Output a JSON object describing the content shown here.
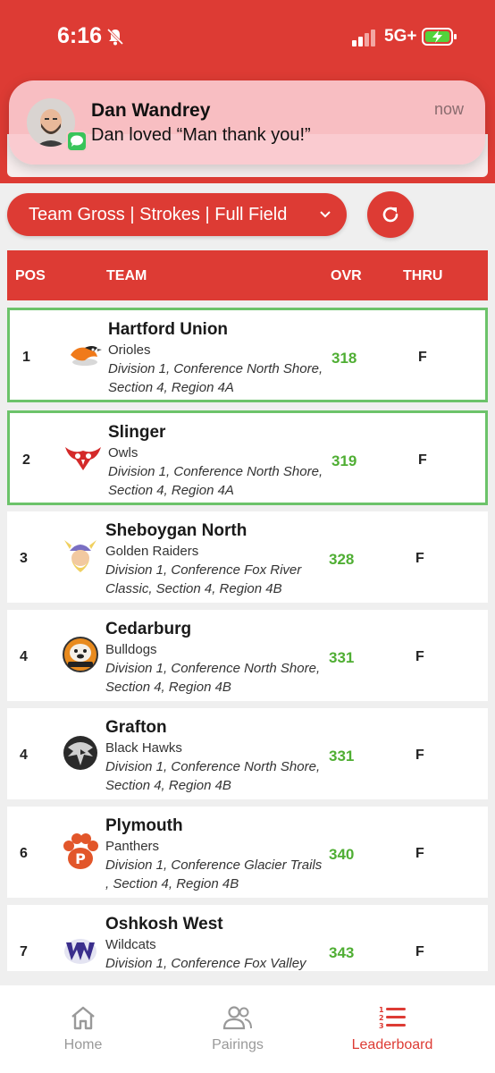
{
  "status_bar": {
    "time": "6:16",
    "network": "5G+"
  },
  "notification": {
    "sender": "Dan Wandrey",
    "message": "Dan loved “Man thank you!”",
    "time": "now"
  },
  "filter": {
    "label": "Team Gross | Strokes | Full Field"
  },
  "table": {
    "headers": {
      "pos": "POS",
      "team": "TEAM",
      "ovr": "OVR",
      "thru": "THRU"
    },
    "rows": [
      {
        "pos": "1",
        "team": "Hartford Union",
        "mascot": "Orioles",
        "info": "Division 1, Conference North Shore, Section 4, Region 4A",
        "ovr": "318",
        "thru": "F",
        "logo": "oriole-logo-icon"
      },
      {
        "pos": "2",
        "team": "Slinger",
        "mascot": "Owls",
        "info": "Division 1, Conference North Shore, Section 4, Region 4A",
        "ovr": "319",
        "thru": "F",
        "logo": "owl-logo-icon"
      },
      {
        "pos": "3",
        "team": "Sheboygan North",
        "mascot": "Golden Raiders",
        "info": "Division 1, Conference Fox River Classic, Section 4, Region 4B",
        "ovr": "328",
        "thru": "F",
        "logo": "raider-logo-icon"
      },
      {
        "pos": "4",
        "team": "Cedarburg",
        "mascot": "Bulldogs",
        "info": "Division 1, Conference North Shore, Section 4, Region 4B",
        "ovr": "331",
        "thru": "F",
        "logo": "bulldog-logo-icon"
      },
      {
        "pos": "4",
        "team": "Grafton",
        "mascot": "Black Hawks",
        "info": "Division 1, Conference North Shore, Section 4, Region 4B",
        "ovr": "331",
        "thru": "F",
        "logo": "hawk-logo-icon"
      },
      {
        "pos": "6",
        "team": "Plymouth",
        "mascot": "Panthers",
        "info": "Division 1, Conference Glacier Trails , Section 4, Region 4B",
        "ovr": "340",
        "thru": "F",
        "logo": "panther-paw-logo-icon"
      },
      {
        "pos": "7",
        "team": "Oshkosh West",
        "mascot": "Wildcats",
        "info": "Division 1, Conference Fox Valley",
        "ovr": "343",
        "thru": "F",
        "logo": "wildcat-logo-icon"
      }
    ]
  },
  "nav": {
    "home": "Home",
    "pairings": "Pairings",
    "leaderboard": "Leaderboard"
  },
  "colors": {
    "brand_red": "#dd3b34",
    "score_green": "#4fae33",
    "leader_border": "#6cc36a"
  }
}
